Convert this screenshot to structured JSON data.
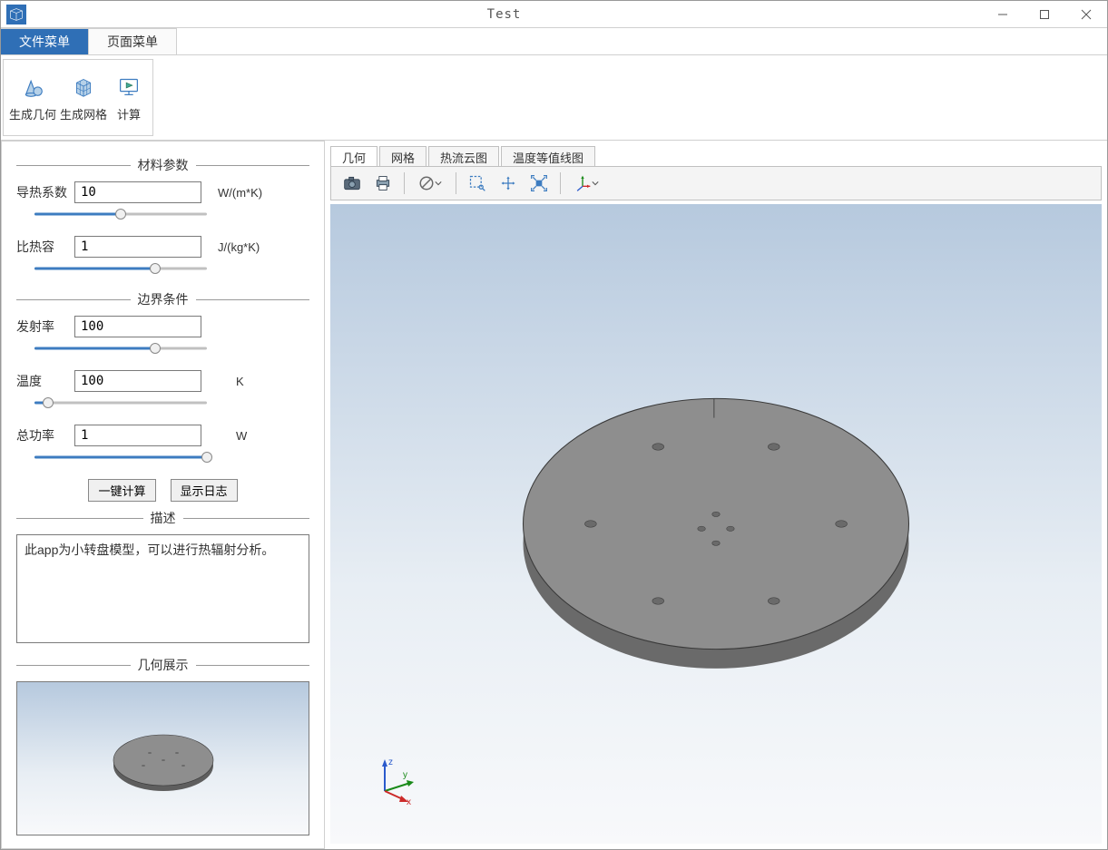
{
  "window": {
    "title": "Test"
  },
  "menu_tabs": [
    {
      "label": "文件菜单",
      "active": true
    },
    {
      "label": "页面菜单",
      "active": false
    }
  ],
  "ribbon": [
    {
      "label": "生成几何",
      "icon": "cone-sphere"
    },
    {
      "label": "生成网格",
      "icon": "cube-mesh"
    },
    {
      "label": "计算",
      "icon": "play-screen"
    }
  ],
  "sidebar": {
    "material": {
      "title": "材料参数",
      "fields": [
        {
          "label": "导热系数",
          "value": "10",
          "unit": "W/(m*K)",
          "slider_pct": 50
        },
        {
          "label": "比热容",
          "value": "1",
          "unit": "J/(kg*K)",
          "slider_pct": 70
        }
      ]
    },
    "boundary": {
      "title": "边界条件",
      "fields": [
        {
          "label": "发射率",
          "value": "100",
          "unit": "",
          "slider_pct": 70
        },
        {
          "label": "温度",
          "value": "100",
          "unit": "K",
          "slider_pct": 8
        },
        {
          "label": "总功率",
          "value": "1",
          "unit": "W",
          "slider_pct": 100
        }
      ]
    },
    "actions": {
      "calc": "一键计算",
      "log": "显示日志"
    },
    "description": {
      "title": "描述",
      "text": "此app为小转盘模型，可以进行热辐射分析。"
    },
    "geom_preview": {
      "title": "几何展示"
    }
  },
  "view_tabs": [
    {
      "label": "几何",
      "active": true
    },
    {
      "label": "网格",
      "active": false
    },
    {
      "label": "热流云图",
      "active": false
    },
    {
      "label": "温度等值线图",
      "active": false
    }
  ],
  "view_toolbar": [
    {
      "name": "camera-icon"
    },
    {
      "name": "printer-icon"
    },
    {
      "sep": true
    },
    {
      "name": "no-icon",
      "drop": true
    },
    {
      "sep": true
    },
    {
      "name": "zoom-box-icon"
    },
    {
      "name": "pan-icon"
    },
    {
      "name": "zoom-extents-icon"
    },
    {
      "sep": true
    },
    {
      "name": "axis-orient-icon",
      "drop": true
    }
  ],
  "triad": {
    "x": "x",
    "y": "y",
    "z": "z"
  }
}
